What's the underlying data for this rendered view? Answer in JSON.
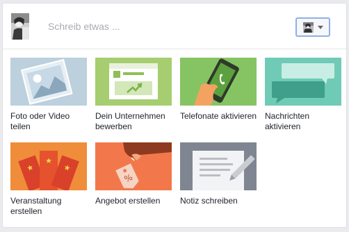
{
  "composer": {
    "placeholder": "Schreib etwas ...",
    "avatar_icon": "profile-photo",
    "audience_icon": "profile-photo-small"
  },
  "tiles": [
    {
      "label": "Foto oder Video teilen",
      "icon": "photo-video-icon",
      "color": "#bcd0de"
    },
    {
      "label": "Dein Unternehmen bewerben",
      "icon": "promote-business-icon",
      "color": "#a6cd6f"
    },
    {
      "label": "Telefonate aktivieren",
      "icon": "phone-call-icon",
      "color": "#86c463"
    },
    {
      "label": "Nachrichten aktivieren",
      "icon": "messages-icon",
      "color": "#6fcbb6"
    },
    {
      "label": "Veranstaltung erstellen",
      "icon": "event-tickets-icon",
      "color": "#f08d3a"
    },
    {
      "label": "Angebot erstellen",
      "icon": "offer-tag-icon",
      "color": "#f2784b"
    },
    {
      "label": "Notiz schreiben",
      "icon": "note-pencil-icon",
      "color": "#7f8692"
    }
  ]
}
